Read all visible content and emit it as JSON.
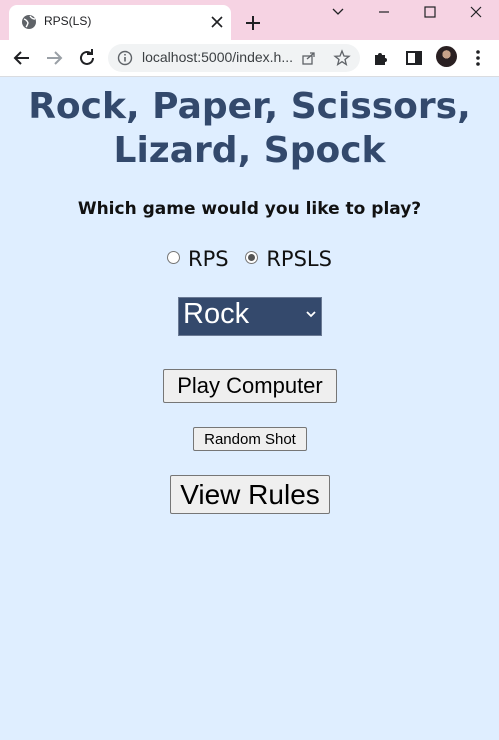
{
  "browser": {
    "tab_title": "RPS(LS)",
    "url": "localhost:5000/index.h...",
    "icons": [
      "globe-icon",
      "close-icon",
      "plus-icon",
      "minimize-icon",
      "restore-icon",
      "back-icon",
      "forward-icon",
      "reload-icon",
      "info-icon",
      "share-icon",
      "star-icon",
      "puzzle-icon",
      "sidebar-icon",
      "menu-icon"
    ]
  },
  "page": {
    "title": "Rock, Paper, Scissors, Lizard, Spock",
    "question": "Which game would you like to play?",
    "game_options": [
      {
        "label": "RPS",
        "checked": false
      },
      {
        "label": "RPSLS",
        "checked": true
      }
    ],
    "shot_select_value": "Rock",
    "buttons": {
      "play": "Play Computer",
      "random": "Random Shot",
      "rules": "View Rules"
    }
  },
  "colors": {
    "page_bg": "#dfeeff",
    "title": "#33496c",
    "select_bg": "#34496c",
    "tabstrip": "#f6d3e3"
  }
}
